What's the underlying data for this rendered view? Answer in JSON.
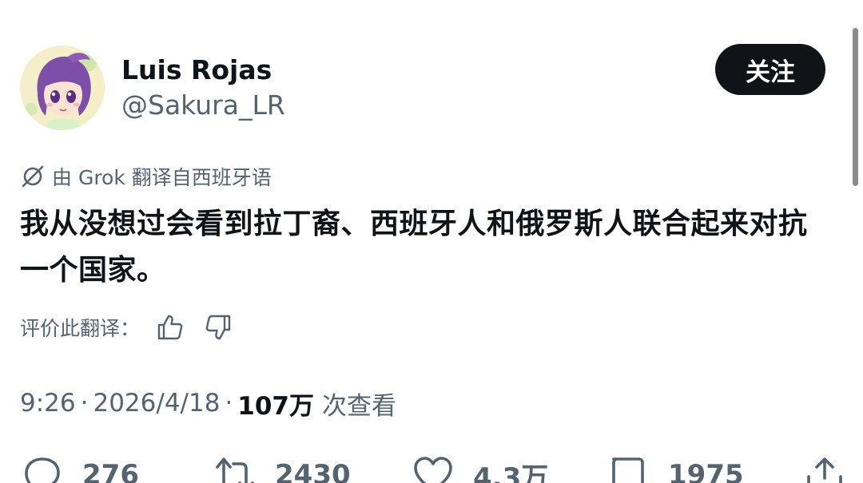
{
  "user": {
    "display_name": "Luis Rojas",
    "handle": "@Sakura_LR",
    "follow_label": "关注"
  },
  "translation": {
    "note": "由 Grok 翻译自西班牙语"
  },
  "tweet": {
    "text": "我从没想过会看到拉丁裔、西班牙人和俄罗斯人联合起来对抗一个国家。"
  },
  "rating": {
    "label": "评价此翻译："
  },
  "meta": {
    "time": "9:26",
    "date": "2026/4/18",
    "views": "107万",
    "views_label": "次查看"
  },
  "actions": {
    "replies": "276",
    "reposts": "2430",
    "likes": "4.3万",
    "bookmarks": "1975"
  },
  "icons": {
    "translate": "grok-icon",
    "thumbs_up": "thumbs-up-icon",
    "thumbs_down": "thumbs-down-icon",
    "reply": "reply-icon",
    "repost": "repost-icon",
    "like": "heart-icon",
    "bookmark": "bookmark-icon",
    "share": "share-icon"
  },
  "colors": {
    "text": "#0f1419",
    "secondary": "#536471",
    "follow_bg": "#0f1419",
    "background": "#ffffff"
  }
}
